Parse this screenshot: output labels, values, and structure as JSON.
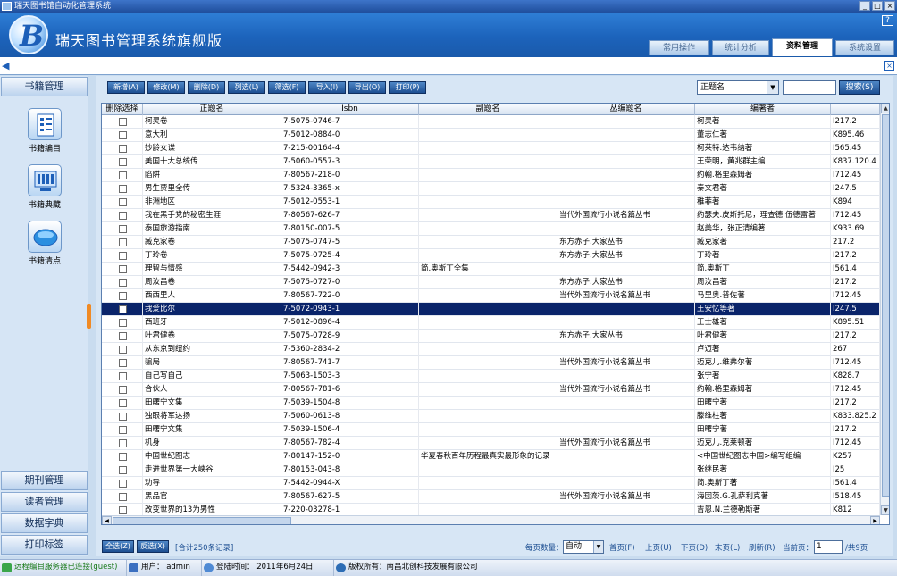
{
  "window": {
    "title": "瑞天图书馆自动化管理系统",
    "min": "_",
    "max": "□",
    "close": "×"
  },
  "header": {
    "app_title": "瑞天图书管理系统旗舰版",
    "logo_letter": "B",
    "help": "?"
  },
  "tabs": [
    {
      "label": "常用操作"
    },
    {
      "label": "统计分析"
    },
    {
      "label": "资料管理"
    },
    {
      "label": "系统设置"
    }
  ],
  "subbar": {
    "close": "×"
  },
  "sidebar": {
    "top_section": "书籍管理",
    "items": [
      {
        "label": "书籍编目"
      },
      {
        "label": "书籍典藏"
      },
      {
        "label": "书籍清点"
      }
    ],
    "bottom_sections": [
      {
        "label": "期刊管理"
      },
      {
        "label": "读者管理"
      },
      {
        "label": "数据字典"
      },
      {
        "label": "打印标签"
      }
    ]
  },
  "toolbar": {
    "buttons": [
      {
        "label": "新增(A)"
      },
      {
        "label": "修改(M)"
      },
      {
        "label": "删除(D)"
      },
      {
        "label": "列选(L)"
      },
      {
        "label": "筛选(F)"
      },
      {
        "label": "导入(I)"
      },
      {
        "label": "导出(O)"
      },
      {
        "label": "打印(P)"
      }
    ],
    "search_field": "正题名",
    "search_value": "",
    "search_button": "搜索(S)"
  },
  "table": {
    "columns": [
      "删除选择",
      "正题名",
      "Isbn",
      "副题名",
      "丛编题名",
      "编著者",
      ""
    ],
    "rows": [
      [
        "柯灵卷",
        "7-5075-0746-7",
        "",
        "",
        "柯灵著",
        "I217.2"
      ],
      [
        "意大利",
        "7-5012-0884-0",
        "",
        "",
        "董志仁著",
        "K895.46"
      ],
      [
        "妙龄女谍",
        "7-215-00164-4",
        "",
        "",
        "柯莱特.达韦纳著",
        "I565.45"
      ],
      [
        "美国十大总统传",
        "7-5060-0557-3",
        "",
        "",
        "王荣明，黄兆群主编",
        "K837.120.4"
      ],
      [
        "陷阱",
        "7-80567-218-0",
        "",
        "",
        "约翰.格里森姆著",
        "I712.45"
      ],
      [
        "男生贾里全传",
        "7-5324-3365-x",
        "",
        "",
        "秦文君著",
        "I247.5"
      ],
      [
        "非洲地区",
        "7-5012-0553-1",
        "",
        "",
        "稚菲著",
        "K894"
      ],
      [
        "我在黑手党的秘密生涯",
        "7-80567-626-7",
        "",
        "当代外国流行小说名篇丛书",
        "约瑟夫.皮斯托尼，理查德.伍德雷著",
        "I712.45"
      ],
      [
        "泰国旅游指南",
        "7-80150-007-5",
        "",
        "",
        "赵美华，张正清编著",
        "K933.69"
      ],
      [
        "臧克家卷",
        "7-5075-0747-5",
        "",
        "东方赤子.大家丛书",
        "臧克家著",
        "217.2"
      ],
      [
        "丁玲卷",
        "7-5075-0725-4",
        "",
        "东方赤子.大家丛书",
        "丁玲著",
        "I217.2"
      ],
      [
        "理智与情感",
        "7-5442-0942-3",
        "简.奥斯丁全集",
        "",
        "简.奥斯丁",
        "I561.4"
      ],
      [
        "周汝昌卷",
        "7-5075-0727-0",
        "",
        "东方赤子.大家丛书",
        "周汝昌著",
        "I217.2"
      ],
      [
        "西西里人",
        "7-80567-722-0",
        "",
        "当代外国流行小说名篇丛书",
        "马里奥.普佐著",
        "I712.45"
      ],
      [
        "我爱比尔",
        "7-5072-0943-1",
        "",
        "",
        "王安忆等著",
        "I247.5"
      ],
      [
        "西班牙",
        "7-5012-0896-4",
        "",
        "",
        "王士雄著",
        "K895.51"
      ],
      [
        "叶君健卷",
        "7-5075-0728-9",
        "",
        "东方赤子.大家丛书",
        "叶君健著",
        "I217.2"
      ],
      [
        "从东京到纽约",
        "7-5360-2834-2",
        "",
        "",
        "卢迈著",
        "267"
      ],
      [
        "骗局",
        "7-80567-741-7",
        "",
        "当代外国流行小说名篇丛书",
        "迈克儿.维弗尔著",
        "I712.45"
      ],
      [
        "自己写自己",
        "7-5063-1503-3",
        "",
        "",
        "张宁著",
        "K828.7"
      ],
      [
        "合伙人",
        "7-80567-781-6",
        "",
        "当代外国流行小说名篇丛书",
        "约翰.格里森姆著",
        "I712.45"
      ],
      [
        "田曙宁文集",
        "7-5039-1504-8",
        "",
        "",
        "田曙宁著",
        "I217.2"
      ],
      [
        "独眼将军达扬",
        "7-5060-0613-8",
        "",
        "",
        "滕维柱著",
        "K833.825.2"
      ],
      [
        "田曙宁文集",
        "7-5039-1506-4",
        "",
        "",
        "田曙宁著",
        "I217.2"
      ],
      [
        "机身",
        "7-80567-782-4",
        "",
        "当代外国流行小说名篇丛书",
        "迈克儿.克莱顿著",
        "I712.45"
      ],
      [
        "中国世纪图志",
        "7-80147-152-0",
        "华夏春秋百年历程最真实最形象的记录",
        "",
        "<中国世纪图志中国>编写组编",
        "K257"
      ],
      [
        "走进世界第一大峡谷",
        "7-80153-043-8",
        "",
        "",
        "张继民著",
        "I25"
      ],
      [
        "劝导",
        "7-5442-0944-X",
        "",
        "",
        "简.奥斯丁著",
        "I561.4"
      ],
      [
        "黑品官",
        "7-80567-627-5",
        "",
        "当代外国流行小说名篇丛书",
        "海因茨.G.孔萨利克著",
        "I518.45"
      ],
      [
        "改变世界的13为男性",
        "7-220-03278-1",
        "",
        "",
        "吉恩.N.兰德勒斯著",
        "K812"
      ]
    ],
    "selected_row": 14,
    "scroll_up": "▲",
    "scroll_down": "▼",
    "scroll_left": "◀",
    "scroll_right": "▶"
  },
  "pager": {
    "select_all": "全选(Z)",
    "invert": "反选(X)",
    "total": "[合计250条记录]",
    "page_size_label": "每页数量：",
    "page_size_value": "自动",
    "first": "首页(F)",
    "prev": "上页(U)",
    "next": "下页(D)",
    "last": "末页(L)",
    "refresh": "刷新(R)",
    "current_label": "当前页：",
    "current_page": "1",
    "total_pages": "/共9页"
  },
  "status": {
    "connection": "远程编目服务器已连接(guest)",
    "user": "用户： admin",
    "login_time": "登陆时间： 2011年6月24日   09:10",
    "copyright": "版权所有：南昌北创科技发展有限公司"
  },
  "colors": {
    "selected_row": "#0a246a",
    "header_blue": "#1c63bb",
    "status_green": "#1a7a1a"
  }
}
